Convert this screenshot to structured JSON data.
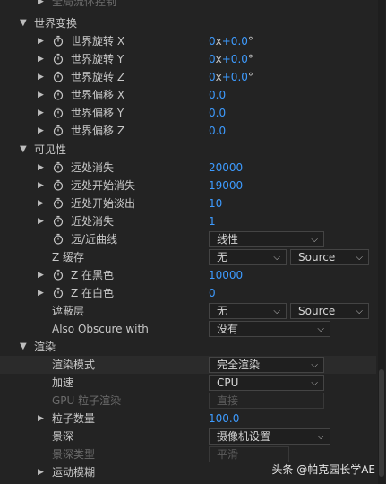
{
  "top_partial": {
    "label": "全局流体控制"
  },
  "sections": {
    "world": {
      "label": "世界变换",
      "rows": [
        {
          "label": "世界旋转 X",
          "value": "0x+0.0°"
        },
        {
          "label": "世界旋转 Y",
          "value": "0x+0.0°"
        },
        {
          "label": "世界旋转 Z",
          "value": "0x+0.0°"
        },
        {
          "label": "世界偏移 X",
          "value": "0.0"
        },
        {
          "label": "世界偏移 Y",
          "value": "0.0"
        },
        {
          "label": "世界偏移 Z",
          "value": "0.0"
        }
      ]
    },
    "visibility": {
      "label": "可见性",
      "rows": [
        {
          "label": "远处消失",
          "value": "20000"
        },
        {
          "label": "远处开始消失",
          "value": "19000"
        },
        {
          "label": "近处开始淡出",
          "value": "10"
        },
        {
          "label": "近处消失",
          "value": "1"
        }
      ],
      "curve": {
        "label": "远/近曲线",
        "value": "线性"
      },
      "zbuffer": {
        "label": "Z 缓存",
        "value": "无",
        "source": "Source"
      },
      "zblack": {
        "label": "Z 在黑色",
        "value": "10000"
      },
      "zwhite": {
        "label": "Z 在白色",
        "value": "0"
      },
      "obscure_layer": {
        "label": "遮蔽层",
        "value": "无",
        "source": "Source"
      },
      "also_obscure": {
        "label": "Also Obscure with",
        "value": "没有"
      }
    },
    "render": {
      "label": "渲染",
      "mode": {
        "label": "渲染模式",
        "value": "完全渲染"
      },
      "accel": {
        "label": "加速",
        "value": "CPU"
      },
      "gpu": {
        "label": "GPU 粒子渲染",
        "value": "直接"
      },
      "particle_count": {
        "label": "粒子数量",
        "value": "100.0"
      },
      "dof": {
        "label": "景深",
        "value": "摄像机设置"
      },
      "dof_type": {
        "label": "景深类型",
        "value": "平滑"
      },
      "motion_blur": {
        "label": "运动模糊"
      }
    }
  },
  "watermark": "头条 @帕克园长学AE",
  "colors": {
    "value_blue": "#3d9bff",
    "background": "#232323"
  }
}
